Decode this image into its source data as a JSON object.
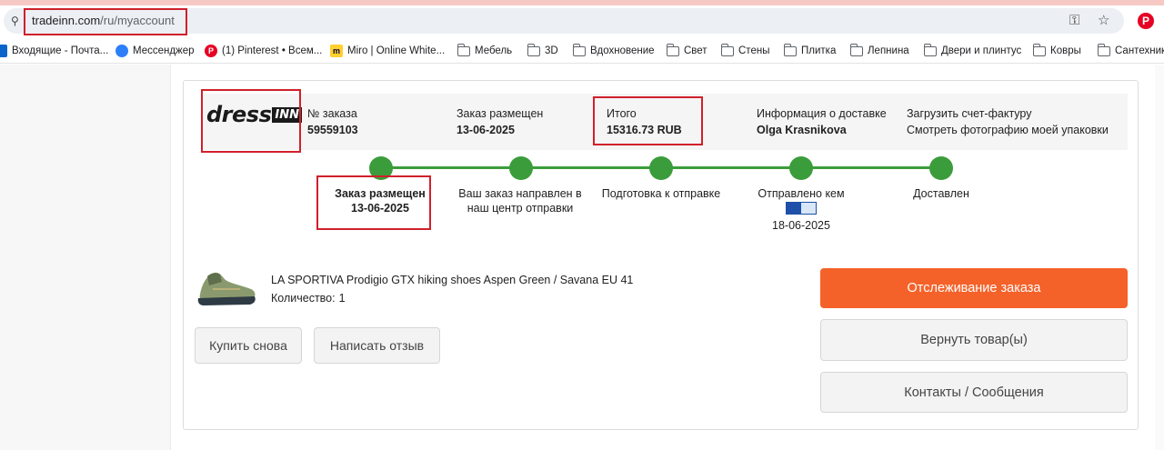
{
  "browser": {
    "url_host": "tradeinn.com",
    "url_path": "/ru/myaccount",
    "bookmarks": [
      {
        "label": "Входящие - Почта...",
        "icon": "outlook-icon"
      },
      {
        "label": "Мессенджер",
        "icon": "messenger-icon"
      },
      {
        "label": "(1) Pinterest • Всем...",
        "icon": "pinterest-icon"
      },
      {
        "label": "Miro | Online White...",
        "icon": "miro-icon"
      },
      {
        "label": "Мебель",
        "icon": "folder-icon"
      },
      {
        "label": "3D",
        "icon": "folder-icon"
      },
      {
        "label": "Вдохновение",
        "icon": "folder-icon"
      },
      {
        "label": "Свет",
        "icon": "folder-icon"
      },
      {
        "label": "Стены",
        "icon": "folder-icon"
      },
      {
        "label": "Плитка",
        "icon": "folder-icon"
      },
      {
        "label": "Лепнина",
        "icon": "folder-icon"
      },
      {
        "label": "Двери и плинтус",
        "icon": "folder-icon"
      },
      {
        "label": "Ковры",
        "icon": "folder-icon"
      },
      {
        "label": "Сантехника",
        "icon": "folder-icon"
      }
    ]
  },
  "order": {
    "logo_main": "dress",
    "logo_box": "INN",
    "number_label": "№ заказа",
    "number_value": "59559103",
    "placed_label": "Заказ размещен",
    "placed_value": "13-06-2025",
    "total_label": "Итого",
    "total_value": "15316.73 RUB",
    "delivery_label": "Информация о доставке",
    "delivery_value": "Olga Krasnikova",
    "invoice_link": "Загрузить счет-фактуру",
    "photo_link": "Смотреть фотографию моей упаковки"
  },
  "timeline": {
    "steps": [
      {
        "line1": "Заказ размещен",
        "line2": "13-06-2025"
      },
      {
        "line1": "Ваш заказ направлен в",
        "line2": "наш центр отправки"
      },
      {
        "line1": "Подготовка к отправке",
        "line2": ""
      },
      {
        "line1": "Отправлено кем",
        "line2": "18-06-2025"
      },
      {
        "line1": "Доставлен",
        "line2": ""
      }
    ],
    "color": "#3b9c3b"
  },
  "product": {
    "name": "LA SPORTIVA Prodigio GTX hiking shoes Aspen Green / Savana EU 41",
    "qty_label": "Количество:",
    "qty_value": "1"
  },
  "buttons": {
    "buy_again": "Купить снова",
    "write_review": "Написать отзыв",
    "track": "Отслеживание заказа",
    "return": "Вернуть товар(ы)",
    "contacts": "Контакты / Сообщения"
  },
  "colors": {
    "accent": "#f4622a",
    "highlight": "#d0202b"
  }
}
